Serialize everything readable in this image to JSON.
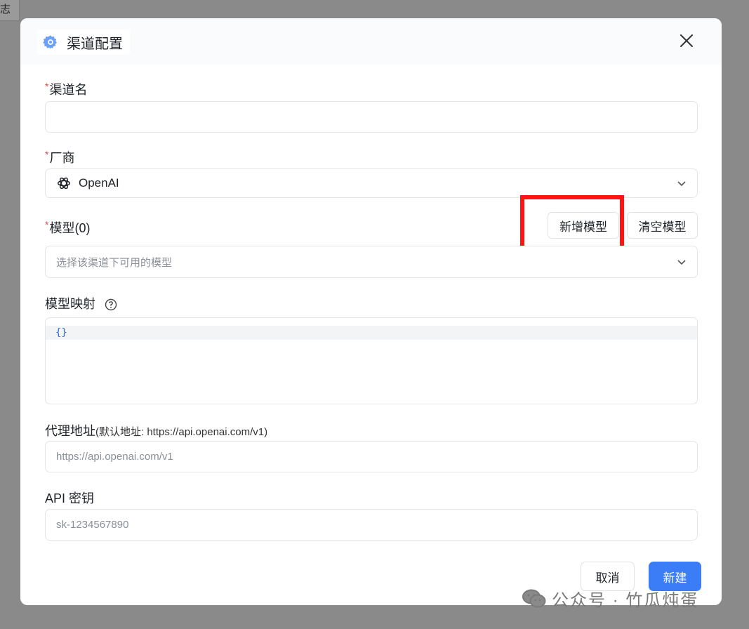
{
  "background_tab": {
    "label": "志"
  },
  "dialog": {
    "title": "渠道配置",
    "icon": "gear-icon",
    "close_icon": "close-icon"
  },
  "fields": {
    "required_mark": "*",
    "channel_name": {
      "label": "渠道名",
      "value": "",
      "placeholder": ""
    },
    "vendor": {
      "label": "厂商",
      "value": "OpenAI",
      "icon": "openai-logo-icon"
    },
    "model": {
      "label": "模型(0)",
      "placeholder": "选择该渠道下可用的模型",
      "add_button": "新增模型",
      "clear_button": "清空模型"
    },
    "model_mapping": {
      "label": "模型映射",
      "value": "{}",
      "help_icon": "question-circle-icon"
    },
    "proxy": {
      "label": "代理地址",
      "hint": "(默认地址: https://api.openai.com/v1)",
      "placeholder": "https://api.openai.com/v1"
    },
    "api_key": {
      "label": "API 密钥",
      "placeholder": "sk-1234567890"
    }
  },
  "footer": {
    "cancel_label": "取消",
    "create_label": "新建"
  },
  "watermark": {
    "text": "公众号 · 竹瓜炖蛋",
    "icon": "wechat-icon"
  },
  "colors": {
    "primary": "#3b7df6",
    "highlight_box": "#ff1414",
    "required": "#e5484d"
  }
}
